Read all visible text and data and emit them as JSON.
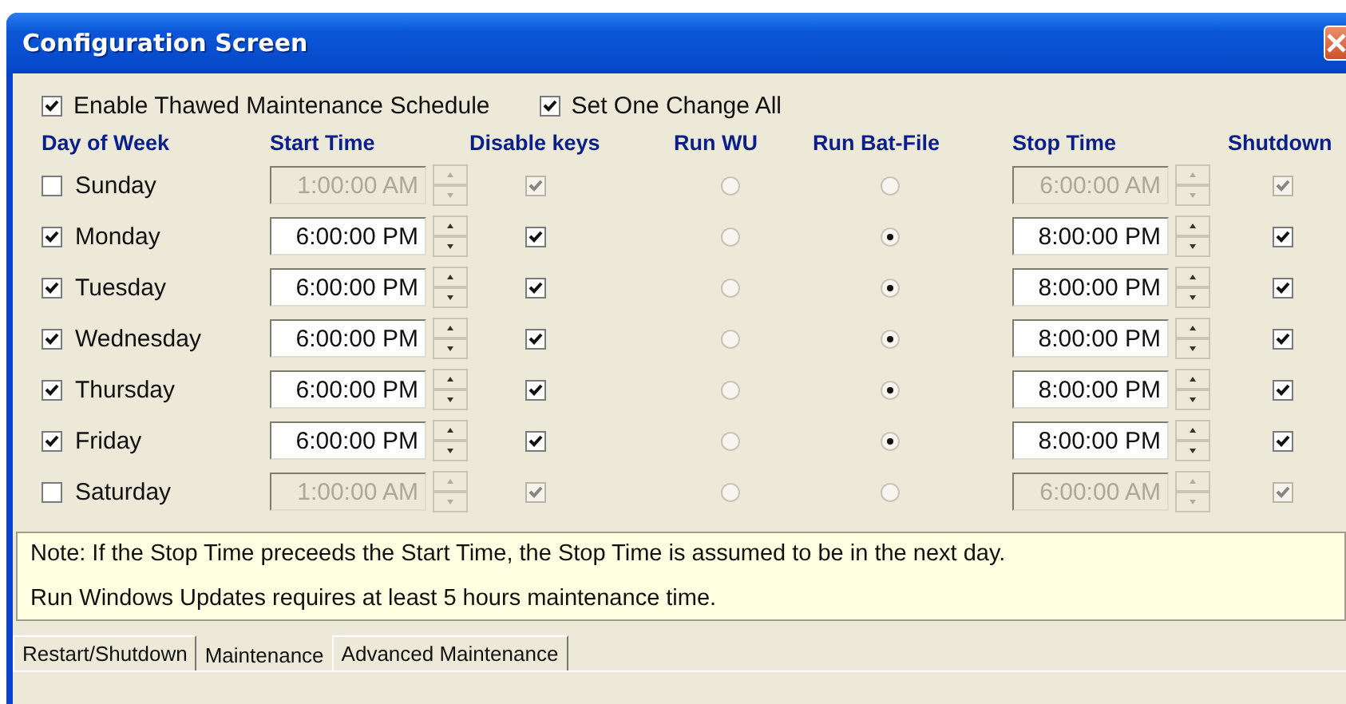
{
  "window": {
    "title": "Configuration Screen"
  },
  "options": [
    {
      "label": "Enable Thawed Maintenance Schedule",
      "checked": true
    },
    {
      "label": "Set One Change All",
      "checked": true
    }
  ],
  "columns": [
    "Day of Week",
    "Start Time",
    "Disable keys",
    "Run WU",
    "Run Bat-File",
    "Stop Time",
    "Shutdown"
  ],
  "rows": [
    {
      "day": "Sunday",
      "checked": false,
      "start_time": "1:00:00 AM",
      "disable_keys": true,
      "run_wu": {
        "selected": false
      },
      "run_bat_file": {
        "selected": false
      },
      "stop_time": "6:00:00 AM",
      "shutdown": true
    },
    {
      "day": "Monday",
      "checked": true,
      "start_time": "6:00:00 PM",
      "disable_keys": true,
      "run_wu": {
        "selected": false
      },
      "run_bat_file": {
        "selected": true
      },
      "stop_time": "8:00:00 PM",
      "shutdown": true
    },
    {
      "day": "Tuesday",
      "checked": true,
      "start_time": "6:00:00 PM",
      "disable_keys": true,
      "run_wu": {
        "selected": false
      },
      "run_bat_file": {
        "selected": true
      },
      "stop_time": "8:00:00 PM",
      "shutdown": true
    },
    {
      "day": "Wednesday",
      "checked": true,
      "start_time": "6:00:00 PM",
      "disable_keys": true,
      "run_wu": {
        "selected": false
      },
      "run_bat_file": {
        "selected": true
      },
      "stop_time": "8:00:00 PM",
      "shutdown": true
    },
    {
      "day": "Thursday",
      "checked": true,
      "start_time": "6:00:00 PM",
      "disable_keys": true,
      "run_wu": {
        "selected": false
      },
      "run_bat_file": {
        "selected": true
      },
      "stop_time": "8:00:00 PM",
      "shutdown": true
    },
    {
      "day": "Friday",
      "checked": true,
      "start_time": "6:00:00 PM",
      "disable_keys": true,
      "run_wu": {
        "selected": false
      },
      "run_bat_file": {
        "selected": true
      },
      "stop_time": "8:00:00 PM",
      "shutdown": true
    },
    {
      "day": "Saturday",
      "checked": false,
      "start_time": "1:00:00 AM",
      "disable_keys": true,
      "run_wu": {
        "selected": false
      },
      "run_bat_file": {
        "selected": false
      },
      "stop_time": "6:00:00 AM",
      "shutdown": true
    }
  ],
  "note": [
    "Note: If the Stop Time preceeds the Start Time, the Stop Time is assumed to be in the next day.",
    "Run Windows Updates requires at least 5 hours maintenance time."
  ],
  "tabs": [
    {
      "label": "Restart/Shutdown",
      "selected": false
    },
    {
      "label": "Maintenance",
      "selected": true
    },
    {
      "label": "Advanced Maintenance",
      "selected": false
    }
  ]
}
